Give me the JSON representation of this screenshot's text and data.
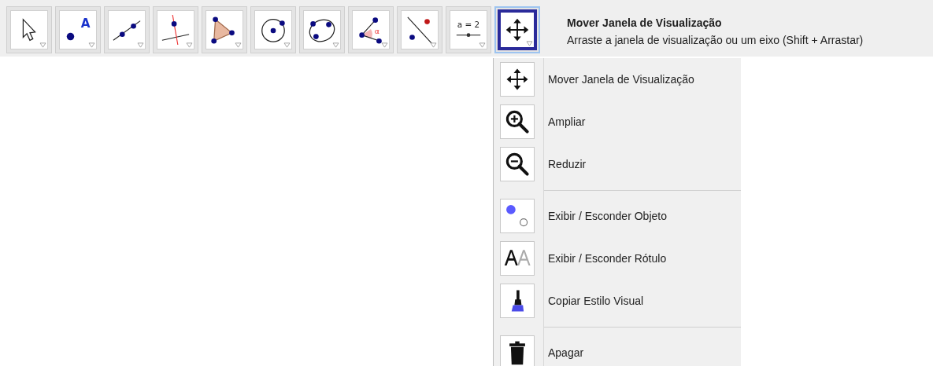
{
  "toolbar": {
    "tools": [
      {
        "kind": "pointer",
        "selected": false
      },
      {
        "kind": "point",
        "glyph": "A",
        "selected": false
      },
      {
        "kind": "line",
        "selected": false
      },
      {
        "kind": "perpendicular",
        "selected": false
      },
      {
        "kind": "polygon",
        "selected": false
      },
      {
        "kind": "circle",
        "selected": false
      },
      {
        "kind": "conic",
        "selected": false
      },
      {
        "kind": "angle",
        "glyph": "α",
        "selected": false
      },
      {
        "kind": "reflect",
        "selected": false
      },
      {
        "kind": "slider",
        "glyph": "a = 2",
        "selected": false
      },
      {
        "kind": "move",
        "selected": true
      }
    ]
  },
  "tooltip": {
    "title": "Mover Janela de Visualização",
    "description": "Arraste a janela de visualização ou um eixo (Shift + Arrastar)"
  },
  "menu": {
    "groups": [
      [
        {
          "kind": "move",
          "label": "Mover Janela de Visualização"
        },
        {
          "kind": "zoom-in",
          "label": "Ampliar"
        },
        {
          "kind": "zoom-out",
          "label": "Reduzir"
        }
      ],
      [
        {
          "kind": "show-object",
          "label": "Exibir / Esconder Objeto"
        },
        {
          "kind": "show-label",
          "label": "Exibir / Esconder Rótulo"
        },
        {
          "kind": "copy-style",
          "label": "Copiar Estilo Visual"
        }
      ],
      [
        {
          "kind": "delete",
          "label": "Apagar"
        }
      ]
    ]
  }
}
